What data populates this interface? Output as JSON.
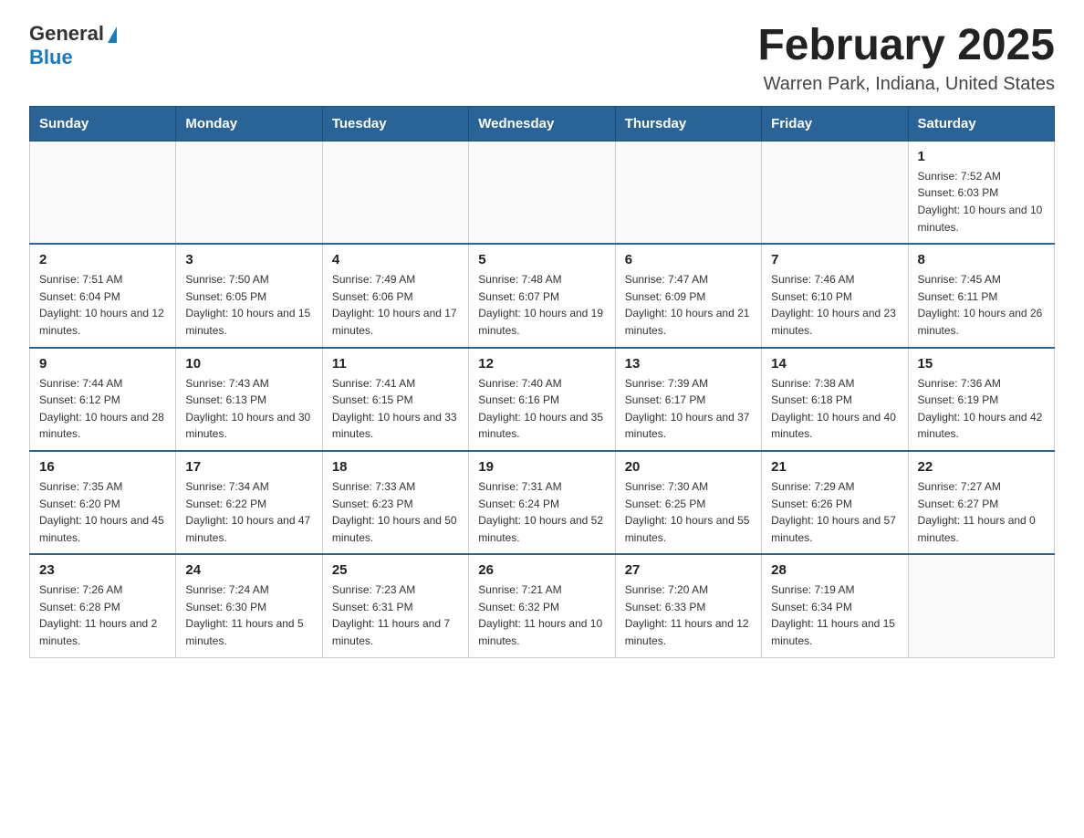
{
  "header": {
    "logo_general": "General",
    "logo_blue": "Blue",
    "month_title": "February 2025",
    "location": "Warren Park, Indiana, United States"
  },
  "days_of_week": [
    "Sunday",
    "Monday",
    "Tuesday",
    "Wednesday",
    "Thursday",
    "Friday",
    "Saturday"
  ],
  "weeks": [
    [
      {
        "day": "",
        "sunrise": "",
        "sunset": "",
        "daylight": ""
      },
      {
        "day": "",
        "sunrise": "",
        "sunset": "",
        "daylight": ""
      },
      {
        "day": "",
        "sunrise": "",
        "sunset": "",
        "daylight": ""
      },
      {
        "day": "",
        "sunrise": "",
        "sunset": "",
        "daylight": ""
      },
      {
        "day": "",
        "sunrise": "",
        "sunset": "",
        "daylight": ""
      },
      {
        "day": "",
        "sunrise": "",
        "sunset": "",
        "daylight": ""
      },
      {
        "day": "1",
        "sunrise": "Sunrise: 7:52 AM",
        "sunset": "Sunset: 6:03 PM",
        "daylight": "Daylight: 10 hours and 10 minutes."
      }
    ],
    [
      {
        "day": "2",
        "sunrise": "Sunrise: 7:51 AM",
        "sunset": "Sunset: 6:04 PM",
        "daylight": "Daylight: 10 hours and 12 minutes."
      },
      {
        "day": "3",
        "sunrise": "Sunrise: 7:50 AM",
        "sunset": "Sunset: 6:05 PM",
        "daylight": "Daylight: 10 hours and 15 minutes."
      },
      {
        "day": "4",
        "sunrise": "Sunrise: 7:49 AM",
        "sunset": "Sunset: 6:06 PM",
        "daylight": "Daylight: 10 hours and 17 minutes."
      },
      {
        "day": "5",
        "sunrise": "Sunrise: 7:48 AM",
        "sunset": "Sunset: 6:07 PM",
        "daylight": "Daylight: 10 hours and 19 minutes."
      },
      {
        "day": "6",
        "sunrise": "Sunrise: 7:47 AM",
        "sunset": "Sunset: 6:09 PM",
        "daylight": "Daylight: 10 hours and 21 minutes."
      },
      {
        "day": "7",
        "sunrise": "Sunrise: 7:46 AM",
        "sunset": "Sunset: 6:10 PM",
        "daylight": "Daylight: 10 hours and 23 minutes."
      },
      {
        "day": "8",
        "sunrise": "Sunrise: 7:45 AM",
        "sunset": "Sunset: 6:11 PM",
        "daylight": "Daylight: 10 hours and 26 minutes."
      }
    ],
    [
      {
        "day": "9",
        "sunrise": "Sunrise: 7:44 AM",
        "sunset": "Sunset: 6:12 PM",
        "daylight": "Daylight: 10 hours and 28 minutes."
      },
      {
        "day": "10",
        "sunrise": "Sunrise: 7:43 AM",
        "sunset": "Sunset: 6:13 PM",
        "daylight": "Daylight: 10 hours and 30 minutes."
      },
      {
        "day": "11",
        "sunrise": "Sunrise: 7:41 AM",
        "sunset": "Sunset: 6:15 PM",
        "daylight": "Daylight: 10 hours and 33 minutes."
      },
      {
        "day": "12",
        "sunrise": "Sunrise: 7:40 AM",
        "sunset": "Sunset: 6:16 PM",
        "daylight": "Daylight: 10 hours and 35 minutes."
      },
      {
        "day": "13",
        "sunrise": "Sunrise: 7:39 AM",
        "sunset": "Sunset: 6:17 PM",
        "daylight": "Daylight: 10 hours and 37 minutes."
      },
      {
        "day": "14",
        "sunrise": "Sunrise: 7:38 AM",
        "sunset": "Sunset: 6:18 PM",
        "daylight": "Daylight: 10 hours and 40 minutes."
      },
      {
        "day": "15",
        "sunrise": "Sunrise: 7:36 AM",
        "sunset": "Sunset: 6:19 PM",
        "daylight": "Daylight: 10 hours and 42 minutes."
      }
    ],
    [
      {
        "day": "16",
        "sunrise": "Sunrise: 7:35 AM",
        "sunset": "Sunset: 6:20 PM",
        "daylight": "Daylight: 10 hours and 45 minutes."
      },
      {
        "day": "17",
        "sunrise": "Sunrise: 7:34 AM",
        "sunset": "Sunset: 6:22 PM",
        "daylight": "Daylight: 10 hours and 47 minutes."
      },
      {
        "day": "18",
        "sunrise": "Sunrise: 7:33 AM",
        "sunset": "Sunset: 6:23 PM",
        "daylight": "Daylight: 10 hours and 50 minutes."
      },
      {
        "day": "19",
        "sunrise": "Sunrise: 7:31 AM",
        "sunset": "Sunset: 6:24 PM",
        "daylight": "Daylight: 10 hours and 52 minutes."
      },
      {
        "day": "20",
        "sunrise": "Sunrise: 7:30 AM",
        "sunset": "Sunset: 6:25 PM",
        "daylight": "Daylight: 10 hours and 55 minutes."
      },
      {
        "day": "21",
        "sunrise": "Sunrise: 7:29 AM",
        "sunset": "Sunset: 6:26 PM",
        "daylight": "Daylight: 10 hours and 57 minutes."
      },
      {
        "day": "22",
        "sunrise": "Sunrise: 7:27 AM",
        "sunset": "Sunset: 6:27 PM",
        "daylight": "Daylight: 11 hours and 0 minutes."
      }
    ],
    [
      {
        "day": "23",
        "sunrise": "Sunrise: 7:26 AM",
        "sunset": "Sunset: 6:28 PM",
        "daylight": "Daylight: 11 hours and 2 minutes."
      },
      {
        "day": "24",
        "sunrise": "Sunrise: 7:24 AM",
        "sunset": "Sunset: 6:30 PM",
        "daylight": "Daylight: 11 hours and 5 minutes."
      },
      {
        "day": "25",
        "sunrise": "Sunrise: 7:23 AM",
        "sunset": "Sunset: 6:31 PM",
        "daylight": "Daylight: 11 hours and 7 minutes."
      },
      {
        "day": "26",
        "sunrise": "Sunrise: 7:21 AM",
        "sunset": "Sunset: 6:32 PM",
        "daylight": "Daylight: 11 hours and 10 minutes."
      },
      {
        "day": "27",
        "sunrise": "Sunrise: 7:20 AM",
        "sunset": "Sunset: 6:33 PM",
        "daylight": "Daylight: 11 hours and 12 minutes."
      },
      {
        "day": "28",
        "sunrise": "Sunrise: 7:19 AM",
        "sunset": "Sunset: 6:34 PM",
        "daylight": "Daylight: 11 hours and 15 minutes."
      },
      {
        "day": "",
        "sunrise": "",
        "sunset": "",
        "daylight": ""
      }
    ]
  ]
}
